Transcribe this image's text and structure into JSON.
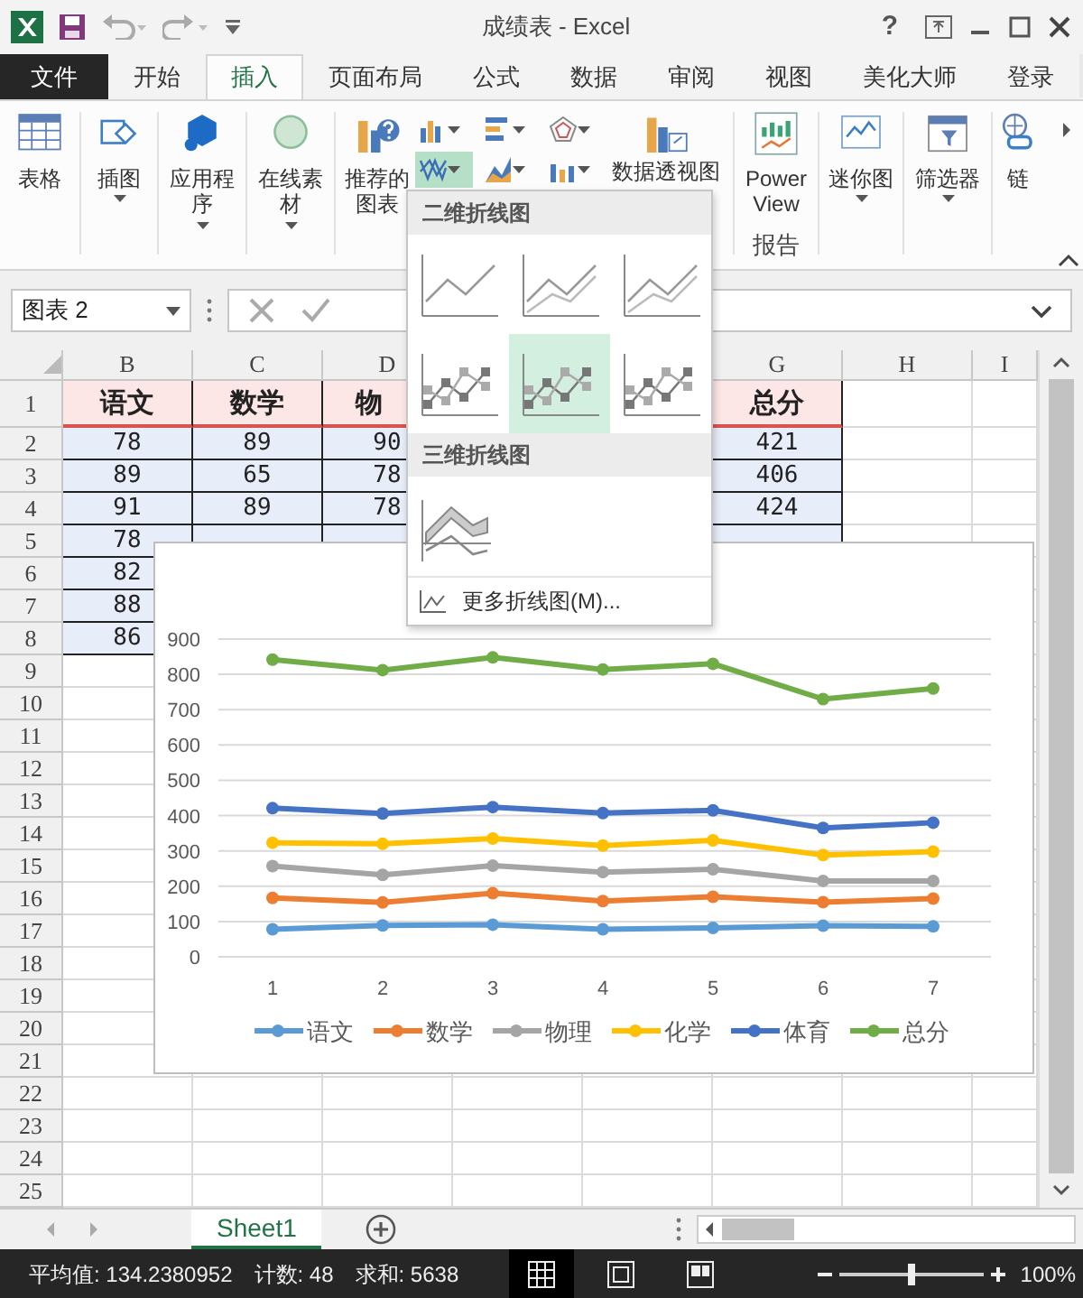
{
  "window": {
    "title": "成绩表 - Excel",
    "help": "?"
  },
  "ribbon_tabs": [
    {
      "label": "文件",
      "kind": "file",
      "selected": false
    },
    {
      "label": "开始",
      "kind": "tab",
      "selected": false
    },
    {
      "label": "插入",
      "kind": "tab",
      "selected": true
    },
    {
      "label": "页面布局",
      "kind": "tab",
      "selected": false
    },
    {
      "label": "公式",
      "kind": "tab",
      "selected": false
    },
    {
      "label": "数据",
      "kind": "tab",
      "selected": false
    },
    {
      "label": "审阅",
      "kind": "tab",
      "selected": false
    },
    {
      "label": "视图",
      "kind": "tab",
      "selected": false
    },
    {
      "label": "美化大师",
      "kind": "tab",
      "selected": false
    },
    {
      "label": "登录",
      "kind": "tab",
      "selected": false
    }
  ],
  "ribbon_buttons": [
    {
      "kind": "table",
      "label": "表格",
      "has_menu": false
    },
    {
      "kind": "illustrations",
      "label": "插图",
      "has_menu": true
    },
    {
      "kind": "apps",
      "label": "应用程序",
      "has_menu": true
    },
    {
      "kind": "online",
      "label": "在线素材",
      "has_menu": true
    },
    {
      "kind": "recommended",
      "label": "推荐的图表",
      "has_menu": false
    },
    {
      "kind": "charts"
    },
    {
      "kind": "pivot",
      "label": "数据透视图",
      "has_menu": false
    },
    {
      "kind": "powerview",
      "label": "Power View",
      "has_menu": false,
      "group": "报告"
    },
    {
      "kind": "sparkline",
      "label": "迷你图",
      "has_menu": true
    },
    {
      "kind": "filter",
      "label": "筛选器",
      "has_menu": true
    },
    {
      "kind": "link",
      "label": "链",
      "has_menu": false
    }
  ],
  "chart_buttons": [
    {
      "kind": "column",
      "selected": false
    },
    {
      "kind": "bar",
      "selected": false
    },
    {
      "kind": "radar",
      "selected": false
    },
    {
      "kind": "line",
      "selected": true
    },
    {
      "kind": "area",
      "selected": false
    },
    {
      "kind": "combo",
      "selected": false
    }
  ],
  "formula_bar": {
    "name_box": "图表 2"
  },
  "sheet": {
    "columns": [
      {
        "label": "B"
      },
      {
        "label": "C"
      },
      {
        "label": "D"
      },
      {},
      {},
      {
        "label": "G"
      },
      {
        "label": "H"
      },
      {
        "label": "I"
      }
    ],
    "rows": [
      {
        "number": "1",
        "kind": "header",
        "cells": [
          {
            "text": "语文"
          },
          {
            "text": "数学"
          },
          {
            "text": "物"
          },
          {},
          {},
          {
            "text": "总分"
          }
        ]
      },
      {
        "number": "2",
        "kind": "data",
        "cells": [
          {
            "text": "78"
          },
          {
            "text": "89"
          },
          {
            "text": "90"
          },
          {},
          {},
          {
            "text": "421"
          }
        ]
      },
      {
        "number": "3",
        "kind": "data",
        "cells": [
          {
            "text": "89"
          },
          {
            "text": "65"
          },
          {
            "text": "78"
          },
          {},
          {},
          {
            "text": "406"
          }
        ]
      },
      {
        "number": "4",
        "kind": "data",
        "cells": [
          {
            "text": "91"
          },
          {
            "text": "89"
          },
          {
            "text": "78"
          },
          {},
          {},
          {
            "text": "424"
          }
        ]
      },
      {
        "number": "5",
        "kind": "data",
        "cells": [
          {
            "text": "78"
          }
        ]
      },
      {
        "number": "6",
        "kind": "data",
        "cells": [
          {
            "text": "82"
          }
        ]
      },
      {
        "number": "7",
        "kind": "data",
        "cells": [
          {
            "text": "88"
          }
        ]
      },
      {
        "number": "8",
        "kind": "data",
        "cells": [
          {
            "text": "86"
          }
        ]
      },
      {
        "number": "9"
      },
      {
        "number": "10"
      },
      {
        "number": "11"
      },
      {
        "number": "12"
      },
      {
        "number": "13"
      },
      {
        "number": "14"
      },
      {
        "number": "15"
      },
      {
        "number": "16"
      },
      {
        "number": "17"
      },
      {
        "number": "18"
      },
      {
        "number": "19"
      },
      {
        "number": "20"
      },
      {
        "number": "21"
      },
      {
        "number": "22"
      },
      {
        "number": "23"
      },
      {
        "number": "24"
      },
      {
        "number": "25"
      }
    ]
  },
  "line_menu": {
    "sections": [
      {
        "title": "二维折线图",
        "options": [
          {
            "kind": "line",
            "selected": false
          },
          {
            "kind": "line",
            "selected": false
          },
          {
            "kind": "line",
            "selected": false
          },
          {
            "kind": "markers",
            "selected": false
          },
          {
            "kind": "markers",
            "selected": true
          },
          {
            "kind": "markers",
            "selected": false
          }
        ]
      },
      {
        "title": "三维折线图",
        "options": [
          {
            "kind": "surface",
            "selected": false
          }
        ]
      }
    ],
    "more": "更多折线图(M)..."
  },
  "chart": {
    "chart_data": {
      "type": "line",
      "categories": [
        "1",
        "2",
        "3",
        "4",
        "5",
        "6",
        "7"
      ],
      "ylim": [
        0,
        900
      ],
      "yticks": [
        0,
        100,
        200,
        300,
        400,
        500,
        600,
        700,
        800,
        900
      ],
      "grid": true,
      "legend": "bottom",
      "series": [
        {
          "name": "语文",
          "color": "#5b9bd5",
          "marker": true,
          "values": [
            78,
            89,
            91,
            78,
            82,
            88,
            86
          ]
        },
        {
          "name": "数学",
          "color": "#ed7d31",
          "marker": true,
          "values": [
            167,
            154,
            180,
            158,
            170,
            155,
            165
          ]
        },
        {
          "name": "物理",
          "color": "#a5a5a5",
          "marker": true,
          "values": [
            257,
            232,
            258,
            240,
            248,
            215,
            215
          ]
        },
        {
          "name": "化学",
          "color": "#ffc000",
          "marker": true,
          "values": [
            323,
            320,
            335,
            315,
            330,
            288,
            298
          ]
        },
        {
          "name": "体育",
          "color": "#4472c4",
          "marker": true,
          "values": [
            421,
            406,
            424,
            407,
            415,
            365,
            380
          ]
        },
        {
          "name": "总分",
          "color": "#70ad47",
          "marker": true,
          "values": [
            842,
            812,
            848,
            814,
            830,
            730,
            760
          ]
        }
      ]
    }
  },
  "sheet_tabs": [
    {
      "label": "Sheet1",
      "selected": true
    }
  ],
  "status_bar": {
    "stats": [
      "平均值: 134.2380952",
      "计数: 48",
      "求和: 5638"
    ],
    "views": [
      {
        "kind": "normal",
        "selected": true
      },
      {
        "kind": "layout",
        "selected": false
      },
      {
        "kind": "pagebreak",
        "selected": false
      }
    ],
    "zoom": {
      "label": "100%",
      "level": 0.5
    }
  }
}
